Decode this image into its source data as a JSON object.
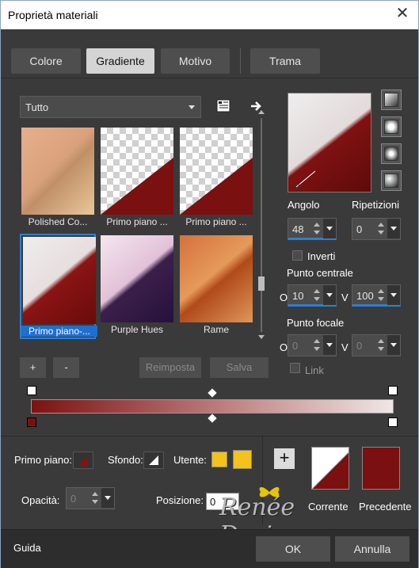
{
  "window": {
    "title": "Proprietà materiali",
    "close_icon": "close-icon"
  },
  "tabs": [
    {
      "label": "Colore",
      "active": false
    },
    {
      "label": "Gradiente",
      "active": true
    },
    {
      "label": "Motivo",
      "active": false
    },
    {
      "label": "Trama",
      "active": false
    }
  ],
  "category": {
    "value": "Tutto"
  },
  "presets": [
    {
      "label": "Polished Co...",
      "selected": false
    },
    {
      "label": "Primo piano ...",
      "selected": false
    },
    {
      "label": "Primo piano ...",
      "selected": false
    },
    {
      "label": "Primo piano-...",
      "selected": true
    },
    {
      "label": "Purple Hues",
      "selected": false
    },
    {
      "label": "Rame",
      "selected": false
    }
  ],
  "buttons": {
    "add": "+",
    "remove": "-",
    "reset": "Reimposta",
    "save": "Salva"
  },
  "params": {
    "angle_label": "Angolo",
    "angle_value": "48",
    "repeat_label": "Ripetizioni",
    "repeat_value": "0",
    "invert_label": "Inverti",
    "center_label": "Punto centrale",
    "center_h_label": "O",
    "center_h_value": "10",
    "center_v_label": "V",
    "center_v_value": "100",
    "focal_label": "Punto focale",
    "focal_h_label": "O",
    "focal_h_value": "0",
    "focal_v_label": "V",
    "focal_v_value": "0",
    "link_label": "Link"
  },
  "bottom": {
    "foreground_label": "Primo piano:",
    "background_label": "Sfondo:",
    "user_label": "Utente:",
    "opacity_label": "Opacità:",
    "opacity_value": "0",
    "position_label": "Posizione:",
    "position_value": "0",
    "current_label": "Corrente",
    "previous_label": "Precedente",
    "watermark": "Renée Design"
  },
  "footer": {
    "help": "Guida",
    "ok": "OK",
    "cancel": "Annulla"
  },
  "colors": {
    "accent": "#2d7fd1",
    "dark_red": "#7a1010",
    "yellow": "#f3c21b"
  }
}
